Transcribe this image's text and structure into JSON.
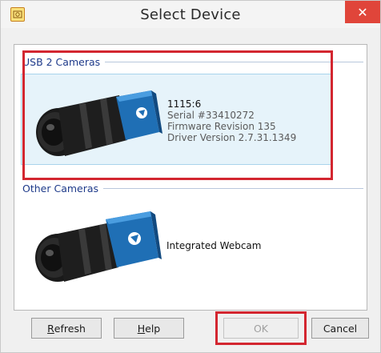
{
  "window": {
    "title": "Select Device",
    "close_glyph": "✕"
  },
  "groups": [
    {
      "label": "USB 2 Cameras",
      "devices": [
        {
          "name": "1115:6",
          "serial": "Serial #33410272",
          "firmware": "Firmware Revision 135",
          "driver": "Driver Version 2.7.31.1349",
          "selected": true
        }
      ]
    },
    {
      "label": "Other Cameras",
      "devices": [
        {
          "name": "Integrated Webcam",
          "selected": false
        }
      ]
    }
  ],
  "buttons": {
    "refresh": {
      "mnemonic": "R",
      "rest": "efresh"
    },
    "help": {
      "mnemonic": "H",
      "rest": "elp"
    },
    "ok": {
      "label": "OK"
    },
    "cancel": {
      "label": "Cancel"
    }
  },
  "colors": {
    "highlight": "#d32630",
    "selection": "#e6f3fa",
    "group_label": "#1e3a8a",
    "close_button": "#e0453a"
  },
  "icons": {
    "app": "camera-app-icon",
    "close": "close-icon",
    "device_camera": "industrial-camera-icon"
  }
}
